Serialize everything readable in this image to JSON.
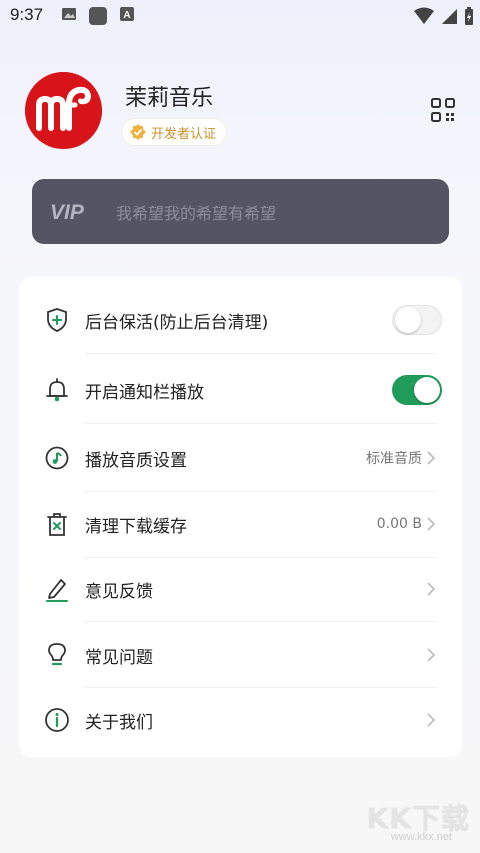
{
  "status_bar": {
    "time": "9:37"
  },
  "profile": {
    "app_name": "茉莉音乐",
    "badge": "开发者认证"
  },
  "vip": {
    "logo_text": "VIP",
    "slogan": "我希望我的希望有希望"
  },
  "settings": {
    "items": [
      {
        "label": "后台保活(防止后台清理)",
        "icon": "shield-plus-icon",
        "control": "toggle",
        "enabled": false
      },
      {
        "label": "开启通知栏播放",
        "icon": "bell-icon",
        "control": "toggle",
        "enabled": true
      },
      {
        "label": "播放音质设置",
        "icon": "music-note-icon",
        "value": "标准音质"
      },
      {
        "label": "清理下载缓存",
        "icon": "trash-icon",
        "value": "0.00 B"
      },
      {
        "label": "意见反馈",
        "icon": "pencil-icon"
      },
      {
        "label": "常见问题",
        "icon": "lightbulb-icon"
      },
      {
        "label": "关于我们",
        "icon": "info-icon"
      }
    ]
  },
  "colors": {
    "accent_green": "#1f9c5a",
    "avatar_red": "#d7141a",
    "badge_gold": "#c8932a",
    "vip_card": "#555465"
  },
  "watermark": {
    "text": "KK下载",
    "url": "www.kkx.net"
  }
}
